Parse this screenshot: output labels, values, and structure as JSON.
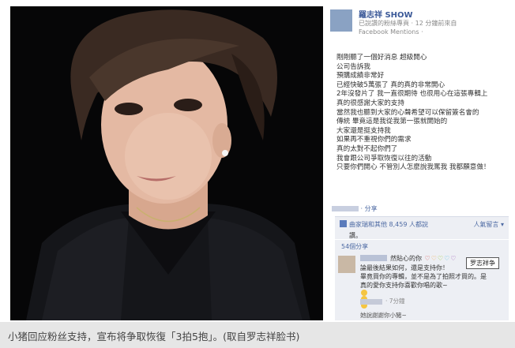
{
  "photo": {
    "description_icon": "portrait-photo"
  },
  "fb": {
    "page_name": "羅志祥 SHOW",
    "page_meta": "已說讚的粉絲專頁 · 12 分鐘前來自",
    "page_mention": "Facebook Mentions ·",
    "post_lines": [
      "剛剛聽了一個好消息 超級開心",
      "公司告訴我",
      "預購成績非常好",
      "已經快破5萬張了 真的真的非常開心",
      "2年沒發片了 我一直很期待 也很用心在這張專輯上",
      "真的很感謝大家的支持",
      "當然我也聽到大家的心聲希望可以保留簽名會的",
      "傳統 畢竟這是我從我第一張就開始的",
      "大家還是挺支持我",
      "如果再不重視你們的需求",
      "真的太對不起你們了",
      "我會跟公司爭取恢復以往的活動",
      "只要你們開心 不管別人怎麼說我罵我 我都願意做！"
    ],
    "actions": "· 分享",
    "likes_text": "曲家瑞和其他 8,459 人都說",
    "popular_label": "人氣留言 ▾",
    "reply_hint": "讚。",
    "shares_label": "54個分享",
    "comment_line1": "然貼心的你",
    "comment_body": [
      "論最後結果如何，還是支持你！",
      "畢竟買你的專輯，並不是為了拍照才買的。是",
      "真的愛你支持你喜歡你唱的歌~"
    ],
    "comment_meta": "· 7分鐘",
    "comment2_text": "她說謝謝你小豬~",
    "tooltip": "罗志祥争"
  },
  "caption": "小猪回应粉丝支持，宣布将争取恢復「3拍5抱」。(取自罗志祥脸书)"
}
